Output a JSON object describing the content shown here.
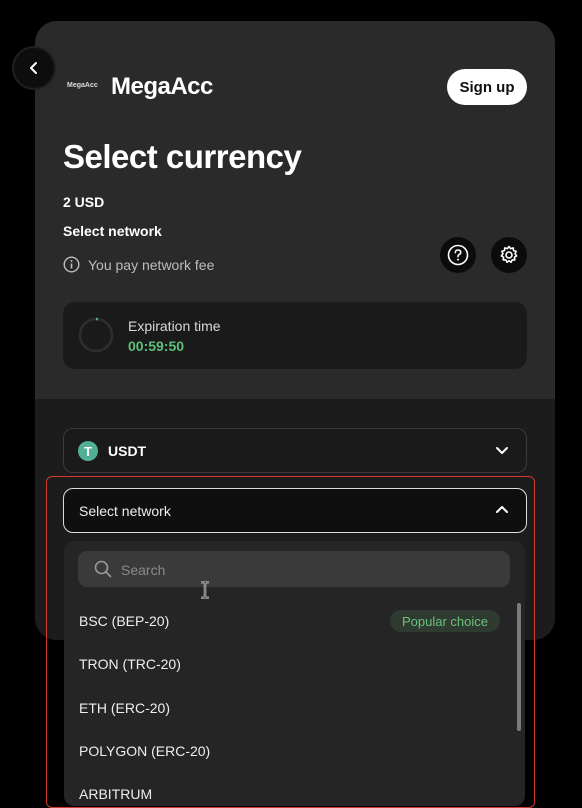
{
  "header": {
    "back_icon": "chevron-left-icon",
    "brand_small": "MegaAcc",
    "brand_big": "MegaAcc",
    "signup_label": "Sign up"
  },
  "main": {
    "title": "Select currency",
    "amount": "2 USD",
    "network_label": "Select network",
    "fee_text": "You pay network fee",
    "help_icon": "question-icon",
    "settings_icon": "gear-icon"
  },
  "expiration": {
    "label": "Expiration time",
    "time": "00:59:50"
  },
  "currency": {
    "symbol": "T",
    "name": "USDT"
  },
  "network_select": {
    "label": "Select network",
    "search_placeholder": "Search",
    "options": [
      {
        "label": "BSC (BEP-20)",
        "badge": "Popular choice"
      },
      {
        "label": "TRON (TRC-20)"
      },
      {
        "label": "ETH (ERC-20)"
      },
      {
        "label": "POLYGON (ERC-20)"
      },
      {
        "label": "ARBITRUM"
      }
    ]
  },
  "colors": {
    "accent_green": "#5fbf7a",
    "frame_red": "#d23a2a",
    "card_bg": "#2a2a2a"
  }
}
